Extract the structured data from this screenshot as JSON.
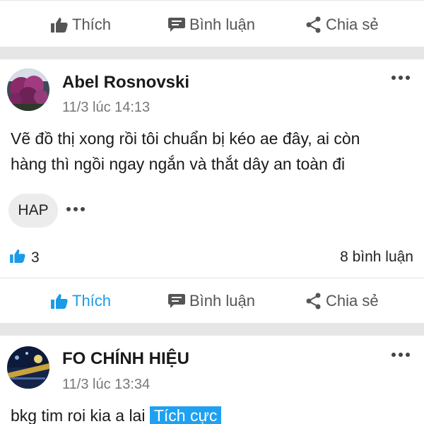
{
  "actions": {
    "like": "Thích",
    "comment": "Bình luận",
    "share": "Chia sẻ"
  },
  "posts": [
    {
      "author": "Abel Rosnovski",
      "time": "11/3 lúc 14:13",
      "text_line1": "Vẽ đồ thị xong rồi tôi chuẩn bị kéo ae đây, ai còn",
      "text_line2": "hàng thì ngồi ngay ngắn và thắt dây an toàn đi",
      "tag": "HAP",
      "like_count": "3",
      "comment_count": "8 bình luận"
    },
    {
      "author": "FO CHÍNH HIỆU",
      "time": "11/3 lúc 13:34",
      "text": "bkg tim roi kia a lai",
      "sentiment": "Tích cực"
    }
  ],
  "colors": {
    "accent": "#1a9be8",
    "sentiment_bg": "#1ea1f2",
    "separator": "#e6e6e6",
    "muted_text": "#777777"
  }
}
